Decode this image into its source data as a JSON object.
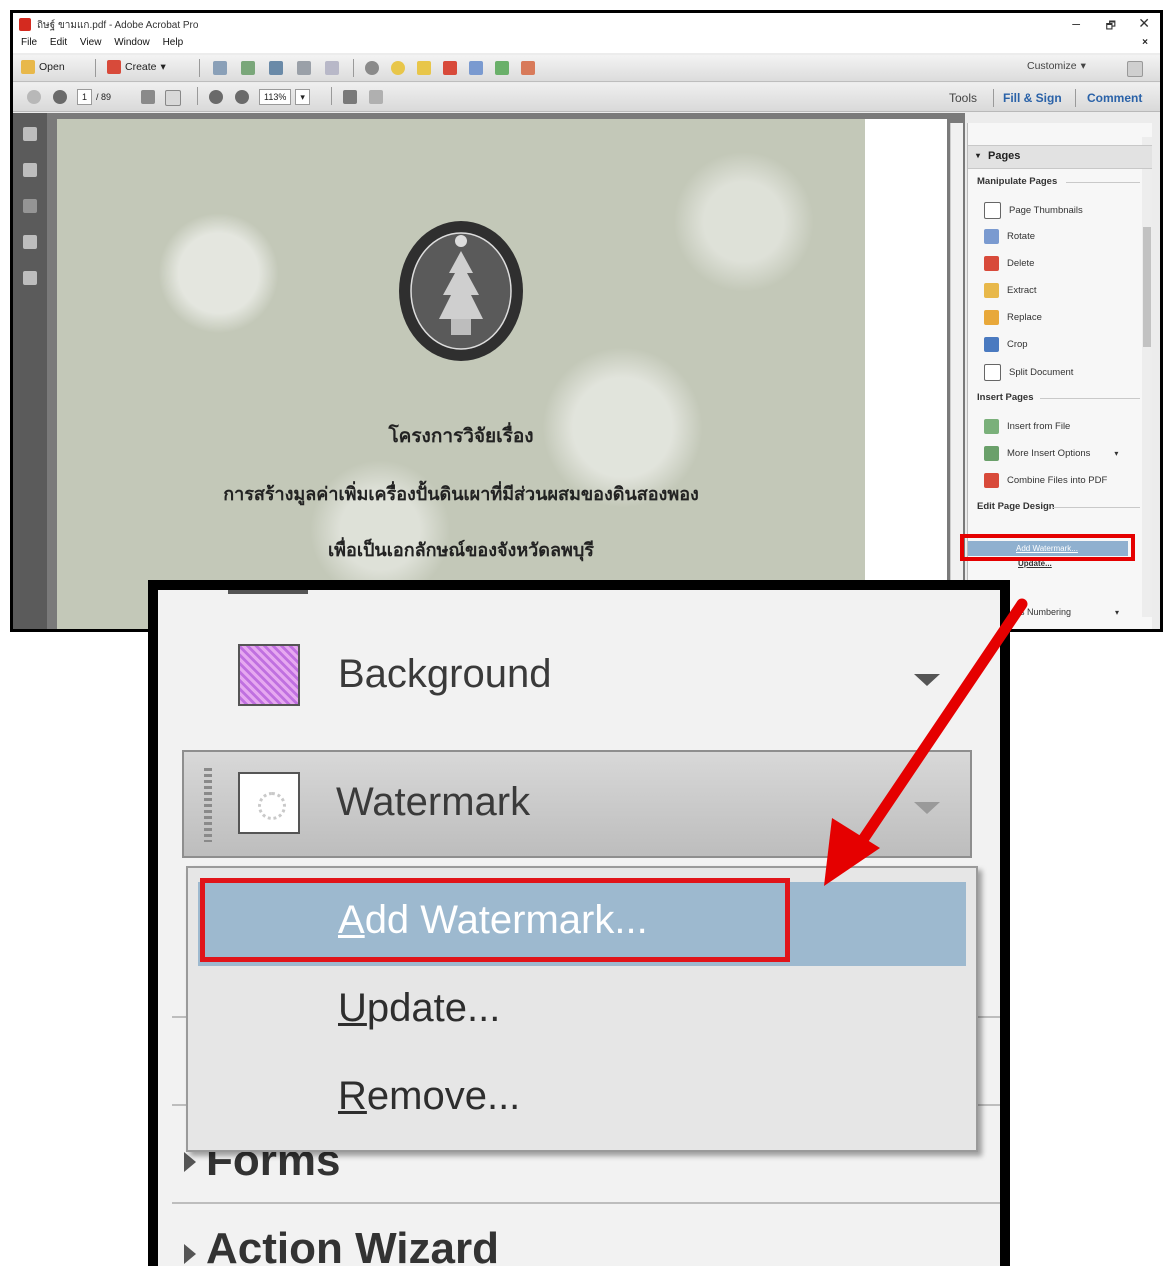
{
  "window": {
    "title": "ถิษฐ์ ขามแก.pdf - Adobe Acrobat Pro",
    "controls": [
      "–",
      "🗗",
      "✕"
    ]
  },
  "menu": [
    "File",
    "Edit",
    "View",
    "Window",
    "Help"
  ],
  "menu_close": "×",
  "toolbar": {
    "open_label": "Open",
    "create_label": "Create",
    "create_arrow": "▾",
    "customize_label": "Customize",
    "customize_arrow": "▾"
  },
  "nav": {
    "page_current": "1",
    "page_total": "/ 89",
    "zoom": "113%",
    "zoom_arrow": "▾",
    "tools": "Tools",
    "fill_sign": "Fill & Sign",
    "comment": "Comment"
  },
  "document": {
    "line1": "โครงการวิจัยเรื่อง",
    "line2": "การสร้างมูลค่าเพิ่มเครื่องปั้นดินเผาที่มีส่วนผสมของดินสองพอง",
    "line3": "เพื่อเป็นเอกลักษณ์ของจังหวัดลพบุรี"
  },
  "pages_panel": {
    "header": "Pages",
    "manipulate_title": "Manipulate Pages",
    "manipulate": [
      "Page Thumbnails",
      "Rotate",
      "Delete",
      "Extract",
      "Replace",
      "Crop",
      "Split Document"
    ],
    "insert_title": "Insert Pages",
    "insert": [
      "Insert from File",
      "More Insert Options",
      "Combine Files into PDF"
    ],
    "more_arrow": "▾",
    "edit_design_title": "Edit Page Design",
    "small_add_watermark": "Add Watermark...",
    "small_update": "Update...",
    "small_numbering": "s Numbering",
    "small_numbering_arrow": "▾"
  },
  "zoom_inset": {
    "background_label": "Background",
    "watermark_label": "Watermark",
    "menu": {
      "add_first": "A",
      "add_rest": "dd Watermark...",
      "update_first": "U",
      "update_rest": "pdate...",
      "remove_first": "R",
      "remove_rest": "emove..."
    },
    "forms_label": "Forms",
    "action_wizard_label": "Action Wizard"
  },
  "colors": {
    "highlight_red": "#e50000",
    "menu_highlight": "#9db9cf",
    "acrobat_red": "#d42a1f"
  }
}
